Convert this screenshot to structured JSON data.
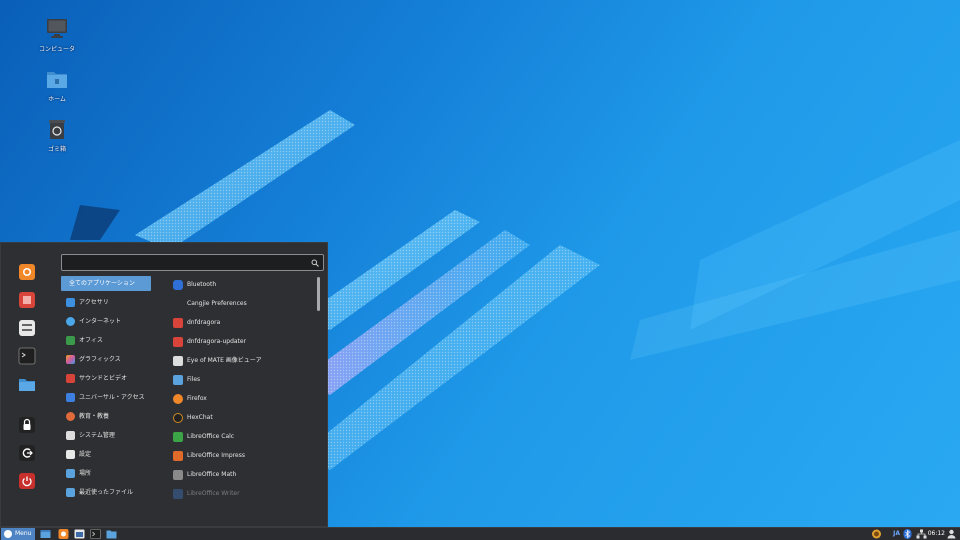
{
  "desktop": {
    "icons": [
      {
        "name": "computer",
        "label": "コンピュータ"
      },
      {
        "name": "home",
        "label": "ホーム"
      },
      {
        "name": "trash",
        "label": "ゴミ箱"
      }
    ]
  },
  "menu": {
    "search": {
      "value": "",
      "placeholder": ""
    },
    "favorites": [
      {
        "name": "firefox-icon",
        "color": "#f0882a"
      },
      {
        "name": "software-icon",
        "color": "#d9443a"
      },
      {
        "name": "settings-icon",
        "color": "#e8e8e8"
      },
      {
        "name": "terminal-icon",
        "color": "#1f1f1f"
      },
      {
        "name": "files-icon",
        "color": "#5aa3df"
      },
      {
        "name": "lock-icon",
        "color": "#222222"
      },
      {
        "name": "logout-icon",
        "color": "#222222"
      },
      {
        "name": "power-icon",
        "color": "#c8302d"
      }
    ],
    "categories": [
      {
        "label": "全てのアプリケーション",
        "icon": "none",
        "color": "#5c9ad6"
      },
      {
        "label": "アクセサリ",
        "icon": "accessories-icon",
        "color": "#3d8fe0"
      },
      {
        "label": "インターネット",
        "icon": "internet-icon",
        "color": "#4aa7ea"
      },
      {
        "label": "オフィス",
        "icon": "office-icon",
        "color": "#3a9a4a"
      },
      {
        "label": "グラフィックス",
        "icon": "graphics-icon",
        "color": "#d05aa0"
      },
      {
        "label": "サウンドとビデオ",
        "icon": "media-icon",
        "color": "#d9443a"
      },
      {
        "label": "ユニバーサル・アクセス",
        "icon": "accessibility-icon",
        "color": "#3d7fe0"
      },
      {
        "label": "教育・教養",
        "icon": "education-icon",
        "color": "#e06a3a"
      },
      {
        "label": "システム管理",
        "icon": "system-icon",
        "color": "#dddddd"
      },
      {
        "label": "設定",
        "icon": "preferences-icon",
        "color": "#e8e8e8"
      },
      {
        "label": "場所",
        "icon": "places-icon",
        "color": "#5aa3df"
      },
      {
        "label": "最近使ったファイル",
        "icon": "recent-icon",
        "color": "#5aa3df"
      }
    ],
    "apps": [
      {
        "label": "Bluetooth",
        "icon": "bluetooth-icon",
        "color": "#2f6fd8"
      },
      {
        "label": "Cangjie Preferences",
        "icon": "none",
        "color": "transparent"
      },
      {
        "label": "dnfdragora",
        "icon": "dnfdragora-icon",
        "color": "#d9443a"
      },
      {
        "label": "dnfdragora-updater",
        "icon": "dnfdragora-updater-icon",
        "color": "#d9443a"
      },
      {
        "label": "Eye of MATE 画像ビューア",
        "icon": "image-viewer-icon",
        "color": "#dddddd"
      },
      {
        "label": "Files",
        "icon": "files-icon",
        "color": "#5aa3df"
      },
      {
        "label": "Firefox",
        "icon": "firefox-icon",
        "color": "#f0882a"
      },
      {
        "label": "HexChat",
        "icon": "hexchat-icon",
        "color": "#222222"
      },
      {
        "label": "LibreOffice Calc",
        "icon": "calc-icon",
        "color": "#3aa447"
      },
      {
        "label": "LibreOffice Impress",
        "icon": "impress-icon",
        "color": "#e06a2a"
      },
      {
        "label": "LibreOffice Math",
        "icon": "math-icon",
        "color": "#8a8a8a"
      },
      {
        "label": "LibreOffice Writer",
        "icon": "writer-icon",
        "color": "#3a6aa8",
        "dim": true
      }
    ]
  },
  "panel": {
    "menu_label": "Menu",
    "clock": "06:12",
    "input_method": "JA"
  }
}
